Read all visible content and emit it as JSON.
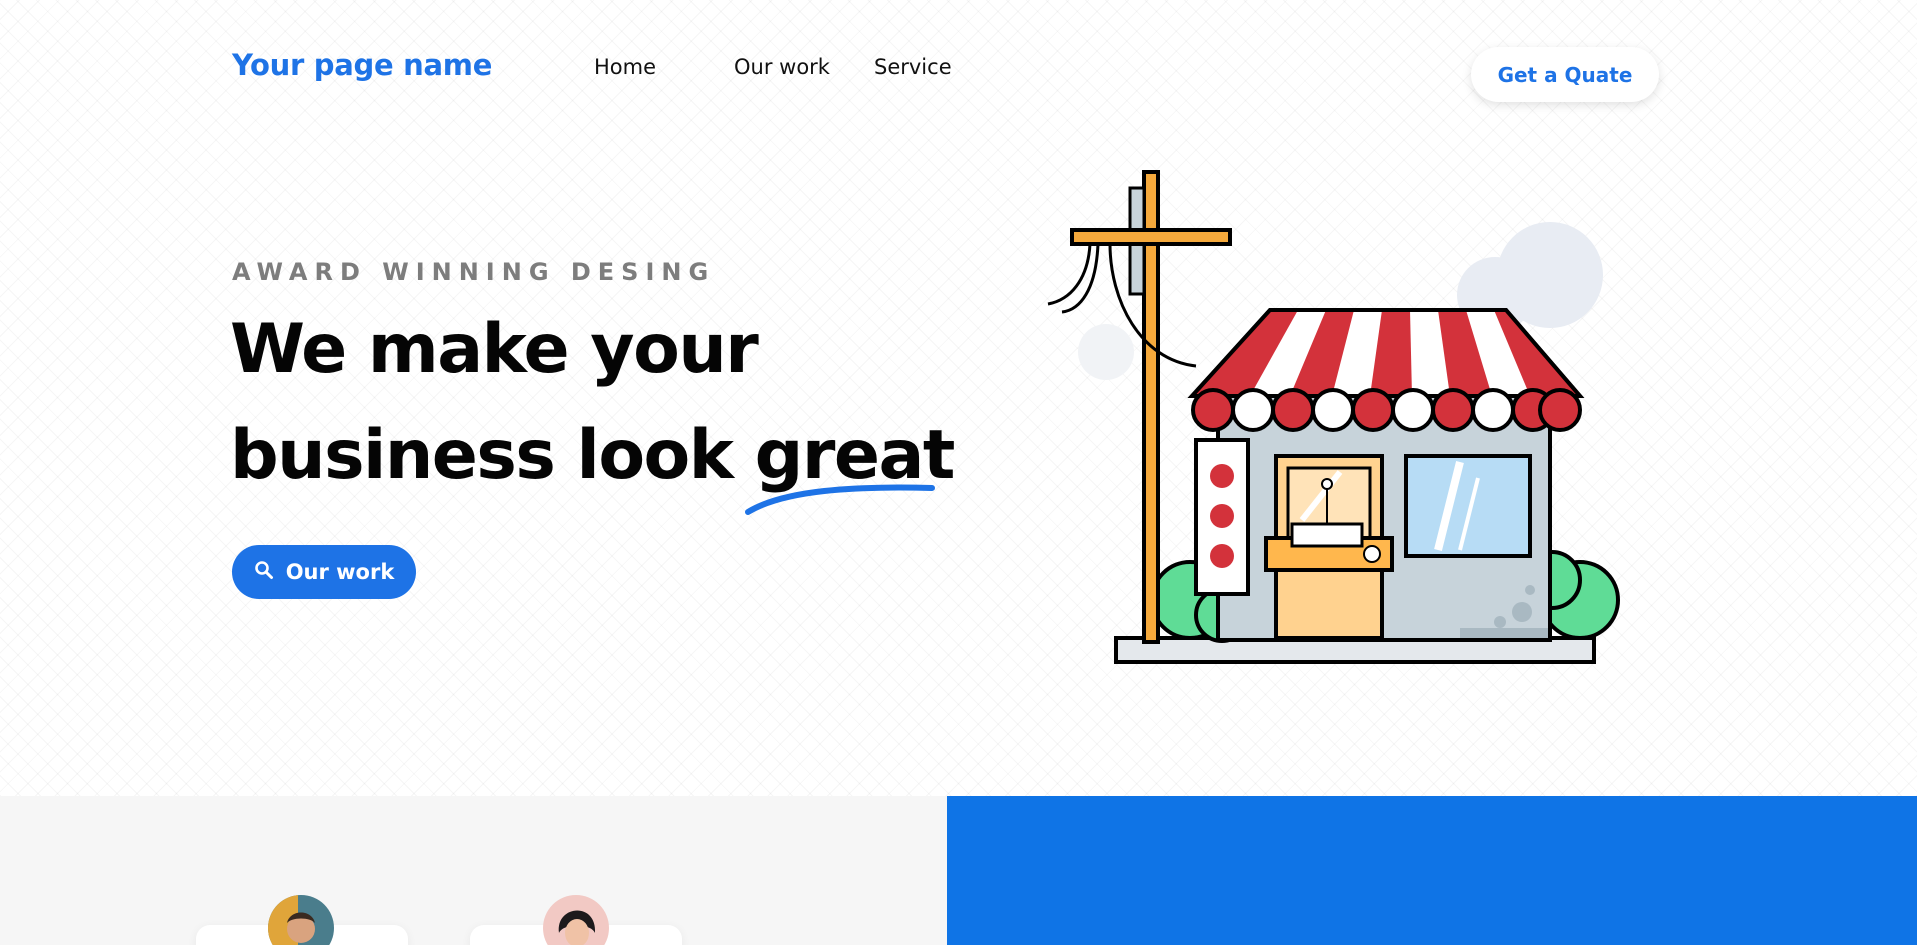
{
  "header": {
    "brand": "Your page name",
    "nav": [
      {
        "label": "Home"
      },
      {
        "label": "Our work"
      },
      {
        "label": "Service"
      }
    ],
    "quote_button": "Get a Quate"
  },
  "hero": {
    "eyebrow": "AWARD WINNING DESING",
    "headline_line1": "We make your",
    "headline_line2_prefix": "business look ",
    "headline_highlight": "great",
    "cta_label": "Our work",
    "cta_icon": "search-icon",
    "illustration": "storefront-illustration"
  },
  "colors": {
    "accent": "#1e73e6",
    "awning_red": "#d3323b",
    "pole_orange": "#f5a93c",
    "bush_green": "#5fdc96",
    "lower_blue": "#0f74e6"
  }
}
